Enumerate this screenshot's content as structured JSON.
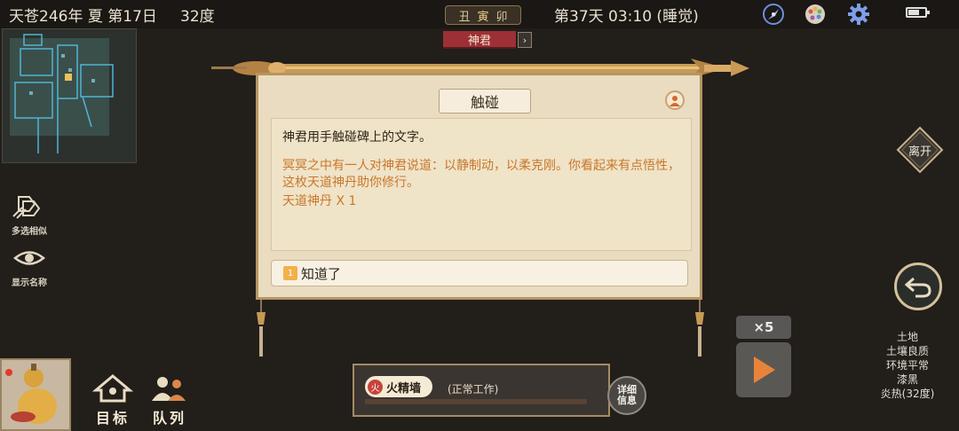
{
  "header": {
    "date": "天苍246年 夏 第17日",
    "temperature": "32度",
    "time_badge": [
      "丑",
      "寅",
      "卯"
    ],
    "day_time": "第37天 03:10 (睡觉)"
  },
  "side_buttons": {
    "multi_select_label": "多选相似",
    "show_names_label": "显示名称"
  },
  "dialog": {
    "speaker": "神君",
    "speaker_next": "›",
    "title": "触碰",
    "line1": "神君用手触碰碑上的文字。",
    "line2": "冥冥之中有一人对神君说道：以静制动，以柔克刚。你看起来有点悟性，这枚天道神丹助你修行。",
    "line3": "天道神丹 X 1",
    "choice_number": "1",
    "choice_label": "知道了"
  },
  "right_panel": {
    "leave_label": "离开",
    "speed_label": "×5",
    "tile_info": [
      "土地",
      "土壤良质",
      "环境平常",
      "漆黑",
      "炎热(32度)"
    ]
  },
  "bottom": {
    "worker_icon": "火",
    "worker_name": "火精墙",
    "worker_status": "(正常工作)",
    "detail_line1": "详细",
    "detail_line2": "信息",
    "goal_label": "目标",
    "team_label": "队列"
  },
  "colors": {
    "background": "#221e1a",
    "parchment": "#e9dcc0",
    "highlight_text": "#c9772a",
    "speaker_tag": "#9d3036",
    "play_orange": "#e8843a"
  },
  "icons": [
    "compass-icon",
    "palette-icon",
    "gear-icon",
    "battery-icon",
    "avatar-icon",
    "back-arrow-icon",
    "play-icon",
    "gourd-icon"
  ]
}
